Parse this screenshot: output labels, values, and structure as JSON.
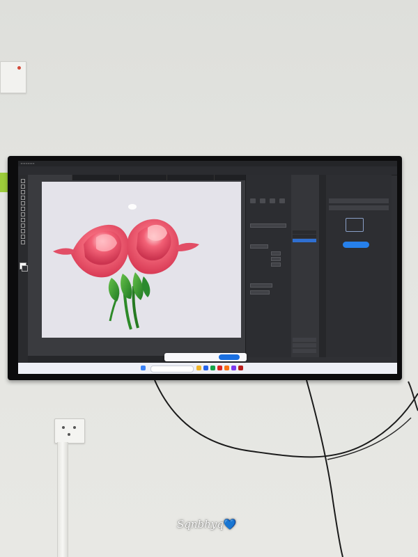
{
  "watermark": {
    "text": "Sqnbhyq",
    "heart": "💙"
  },
  "scene": {
    "subject": "wall-mounted-tv",
    "screen_app_icon": "illustration-app-icon",
    "artwork": "two-pink-roses-with-green-stems",
    "colors": {
      "wall": "#e2e2de",
      "rose": "#e8536a",
      "rose_highlight": "#ffc0c4",
      "stem": "#2f8a2a",
      "accent_button": "#2680eb"
    }
  }
}
